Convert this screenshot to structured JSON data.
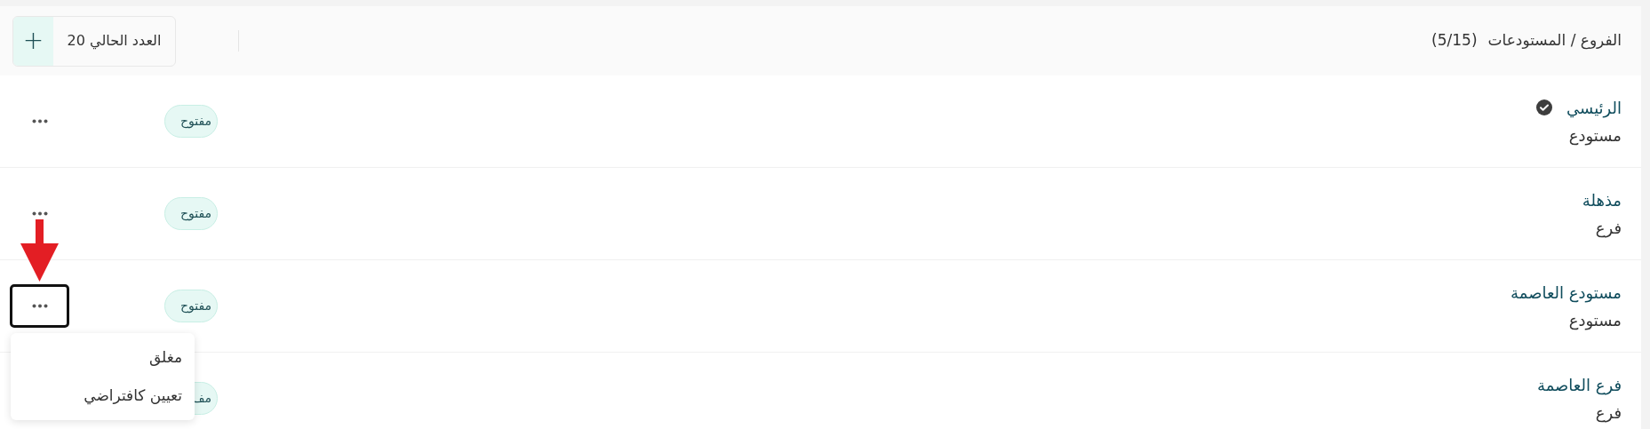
{
  "header": {
    "title": "الفروع / المستودعات",
    "count": "(5/15)",
    "current_count": "العدد الحالي 20",
    "add_symbol": "+"
  },
  "rows": [
    {
      "name": "الرئيسي",
      "type": "مستودع",
      "default": true,
      "status": "مفتوح",
      "more_button": true,
      "highlighted": false
    },
    {
      "name": "مذهلة",
      "type": "فرع",
      "default": false,
      "status": "مفتوح",
      "more_button": true,
      "highlighted": false
    },
    {
      "name": "مستودع العاصمة",
      "type": "مستودع",
      "default": false,
      "status": "مفتوح",
      "more_button": true,
      "highlighted": true
    },
    {
      "name": "فرع العاصمة",
      "type": "فرع",
      "default": false,
      "status": "مف",
      "more_button": false
    }
  ],
  "menu": {
    "items": [
      "مغلق",
      "تعيين كافتراضي"
    ]
  }
}
